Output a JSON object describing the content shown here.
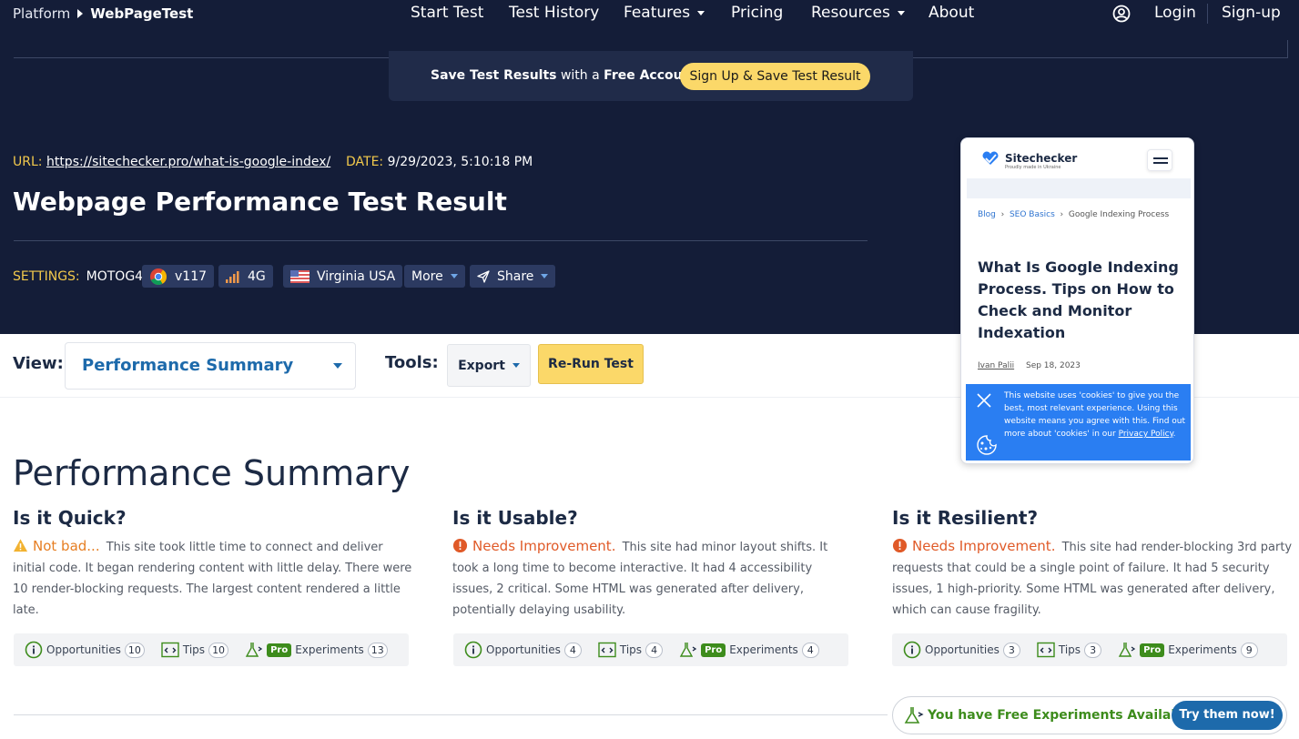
{
  "nav": {
    "platform": "Platform",
    "brand": "WebPageTest",
    "links": [
      {
        "label": "Start Test",
        "dropdown": false
      },
      {
        "label": "Test History",
        "dropdown": false
      },
      {
        "label": "Features",
        "dropdown": true
      },
      {
        "label": "Pricing",
        "dropdown": false
      },
      {
        "label": "Resources",
        "dropdown": true
      },
      {
        "label": "About",
        "dropdown": false
      }
    ],
    "login": "Login",
    "signup": "Sign-up"
  },
  "save_banner": {
    "text_bold1": "Save Test Results",
    "text_mid": " with a ",
    "text_bold2": "Free Account",
    "button": "Sign Up & Save Test Result"
  },
  "result": {
    "url_label": "URL:",
    "url": "https://sitechecker.pro/what-is-google-index/",
    "date_label": "DATE:",
    "date": "9/29/2023, 5:10:18 PM",
    "title": "Webpage Performance Test Result"
  },
  "settings": {
    "label": "SETTINGS:",
    "device": "MOTOG4",
    "browser": "v117",
    "network": "4G",
    "location": "Virginia USA",
    "more": "More",
    "share": "Share"
  },
  "toolbar": {
    "view_label": "View:",
    "view_value": "Performance Summary",
    "tools_label": "Tools:",
    "export": "Export",
    "rerun": "Re-Run Test"
  },
  "thumbnail": {
    "logo": "Sitechecker",
    "logo_sub": "Proudly made in Ukraine",
    "breadcrumb": [
      "Blog",
      "SEO Basics",
      "Google Indexing Process"
    ],
    "article_title": "What Is Google Indexing Process. Tips on How to Check and Monitor Indexation",
    "author": "Ivan Palii",
    "article_date": "Sep 18, 2023",
    "cookie_text": "This website uses 'cookies' to give you the best, most relevant experience. Using this website means you agree with this. Find out more about 'cookies' in our ",
    "cookie_link": "Privacy Policy",
    "cookie_end": "."
  },
  "summary": {
    "title": "Performance Summary",
    "columns": [
      {
        "heading": "Is it Quick?",
        "status": "Not bad...",
        "status_kind": "warn",
        "text": " This site took little time to connect and deliver initial code. It began rendering content with little delay. There were 10 render-blocking requests. The largest content rendered a little late.",
        "opportunities_label": "Opportunities",
        "opportunities": "10",
        "tips_label": "Tips",
        "tips": "10",
        "pro": "Pro",
        "experiments_label": "Experiments",
        "experiments": "13"
      },
      {
        "heading": "Is it Usable?",
        "status": "Needs Improvement.",
        "status_kind": "bad",
        "text": " This site had minor layout shifts. It took a long time to become interactive. It had 4 accessibility issues, 2 critical. Some HTML was generated after delivery, potentially delaying usability.",
        "opportunities_label": "Opportunities",
        "opportunities": "4",
        "tips_label": "Tips",
        "tips": "4",
        "pro": "Pro",
        "experiments_label": "Experiments",
        "experiments": "4"
      },
      {
        "heading": "Is it Resilient?",
        "status": "Needs Improvement.",
        "status_kind": "bad",
        "text": " This site had render-blocking 3rd party requests that could be a single point of failure. It had 5 security issues, 1 high-priority. Some HTML was generated after delivery, which can cause fragility.",
        "opportunities_label": "Opportunities",
        "opportunities": "3",
        "tips_label": "Tips",
        "tips": "3",
        "pro": "Pro",
        "experiments_label": "Experiments",
        "experiments": "9"
      }
    ]
  },
  "promo": {
    "text": "You have Free Experiments Available!",
    "button": "Try them now!"
  },
  "colors": {
    "header_bg": "#141d38",
    "accent_yellow": "#fbd869",
    "link_blue": "#1d6aab",
    "pro_green": "#3d8c1c",
    "warn_orange": "#e67e22",
    "bad_orange": "#e05a28"
  },
  "icons": {
    "user": "user-circle-icon",
    "chrome": "chrome-icon",
    "signal": "signal-bars-icon",
    "flag": "us-flag-icon",
    "share": "paper-plane-icon",
    "warning": "warning-triangle-icon",
    "error": "exclamation-circle-icon",
    "info": "info-circle-icon",
    "code": "code-window-icon",
    "flask": "flask-icon",
    "close": "close-icon",
    "cookie": "cookie-icon",
    "hamburger": "hamburger-icon"
  }
}
